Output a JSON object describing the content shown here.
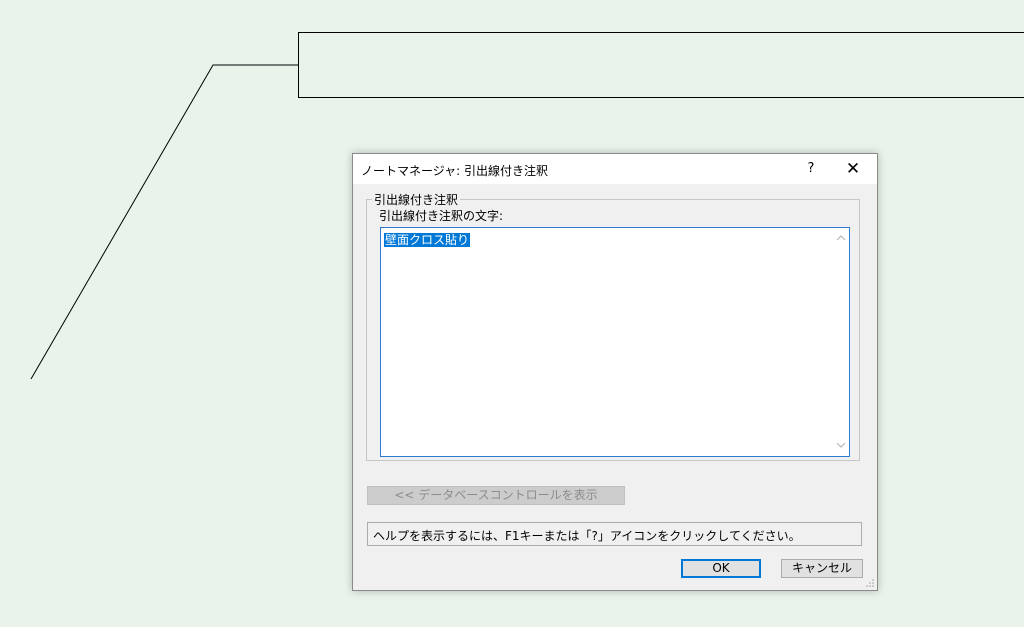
{
  "dialog": {
    "title": "ノートマネージャ: 引出線付き注釈",
    "help_icon": "?",
    "close_icon": "✕",
    "group_title": "引出線付き注釈",
    "field_label": "引出線付き注釈の文字:",
    "text_value": "壁面クロス貼り",
    "db_button_label": "<< データベースコントロールを表示",
    "status_text": "ヘルプを表示するには、F1キーまたは「?」アイコンをクリックしてください。",
    "ok_label": "OK",
    "cancel_label": "キャンセル"
  },
  "icons": {
    "help": "question-mark-icon",
    "close": "close-icon",
    "scroll_up": "chevron-up-icon",
    "scroll_down": "chevron-down-icon",
    "resize": "resize-grip-icon"
  },
  "colors": {
    "background": "#e9f3ea",
    "accent": "#0078d7",
    "dialog_bg": "#f0f0f0"
  }
}
